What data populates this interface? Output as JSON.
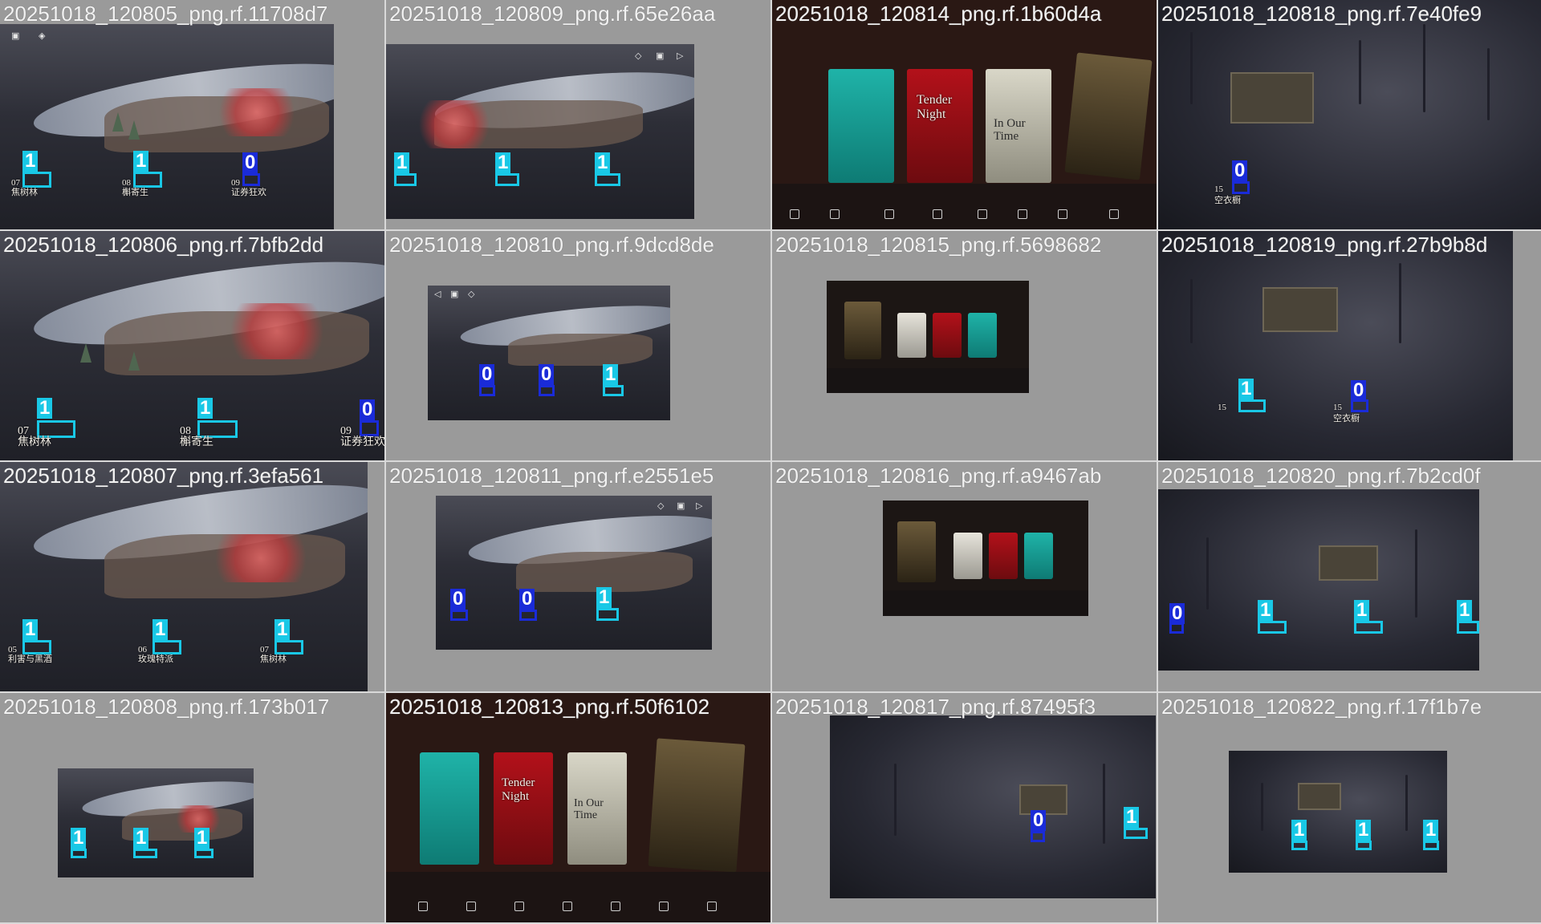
{
  "tiles": [
    {
      "title": "20251018_120805_png.rf.11708d7",
      "hud": [
        "▣",
        "◈"
      ],
      "labels": [
        {
          "cls": "1",
          "cap": "07",
          "name": "焦树林"
        },
        {
          "cls": "1",
          "cap": "08",
          "name": "槲寄生"
        },
        {
          "cls": "0",
          "cap": "09",
          "name": "证券狂欢"
        }
      ]
    },
    {
      "title": "20251018_120809_png.rf.65e26aa",
      "hud": [
        "◇",
        "▣",
        "▷"
      ],
      "labels": [
        {
          "cls": "1",
          "cap": "",
          "name": ""
        },
        {
          "cls": "1",
          "cap": "",
          "name": ""
        },
        {
          "cls": "1",
          "cap": "",
          "name": ""
        }
      ]
    },
    {
      "title": "20251018_120814_png.rf.1b60d4a",
      "cards": [
        "Tender Night",
        "In Our Time"
      ],
      "labels": []
    },
    {
      "title": "20251018_120818_png.rf.7e40fe9",
      "labels": [
        {
          "cls": "0",
          "cap": "15",
          "name": "空衣橱"
        }
      ]
    },
    {
      "title": "20251018_120806_png.rf.7bfb2dd",
      "labels": [
        {
          "cls": "1",
          "cap": "07",
          "name": "焦树林"
        },
        {
          "cls": "1",
          "cap": "08",
          "name": "槲寄生"
        },
        {
          "cls": "0",
          "cap": "09",
          "name": "证券狂欢"
        }
      ]
    },
    {
      "title": "20251018_120810_png.rf.9dcd8de",
      "hud": [
        "◁",
        "▣",
        "◇"
      ],
      "labels": [
        {
          "cls": "0",
          "cap": "",
          "name": ""
        },
        {
          "cls": "0",
          "cap": "",
          "name": ""
        },
        {
          "cls": "1",
          "cap": "",
          "name": ""
        }
      ]
    },
    {
      "title": "20251018_120815_png.rf.5698682",
      "labels": []
    },
    {
      "title": "20251018_120819_png.rf.27b9b8d",
      "labels": [
        {
          "cls": "1",
          "cap": "15",
          "name": ""
        },
        {
          "cls": "0",
          "cap": "15",
          "name": "空衣橱"
        }
      ]
    },
    {
      "title": "20251018_120807_png.rf.3efa561",
      "labels": [
        {
          "cls": "1",
          "cap": "05",
          "name": "利害与黑酒"
        },
        {
          "cls": "1",
          "cap": "06",
          "name": "玫瑰特派"
        },
        {
          "cls": "1",
          "cap": "07",
          "name": "焦树林"
        }
      ]
    },
    {
      "title": "20251018_120811_png.rf.e2551e5",
      "hud": [
        "◇",
        "▣",
        "▷"
      ],
      "labels": [
        {
          "cls": "0",
          "cap": "",
          "name": ""
        },
        {
          "cls": "0",
          "cap": "",
          "name": ""
        },
        {
          "cls": "1",
          "cap": "",
          "name": ""
        }
      ]
    },
    {
      "title": "20251018_120816_png.rf.a9467ab",
      "labels": []
    },
    {
      "title": "20251018_120820_png.rf.7b2cd0f",
      "labels": [
        {
          "cls": "0",
          "cap": "",
          "name": ""
        },
        {
          "cls": "1",
          "cap": "",
          "name": ""
        },
        {
          "cls": "1",
          "cap": "",
          "name": ""
        },
        {
          "cls": "1",
          "cap": "",
          "name": ""
        }
      ]
    },
    {
      "title": "20251018_120808_png.rf.173b017",
      "labels": [
        {
          "cls": "1"
        },
        {
          "cls": "1"
        },
        {
          "cls": "1"
        }
      ]
    },
    {
      "title": "20251018_120813_png.rf.50f6102",
      "cards": [
        "Tender Night",
        "In Our Time"
      ],
      "labels": []
    },
    {
      "title": "20251018_120817_png.rf.87495f3",
      "labels": [
        {
          "cls": "0",
          "cap": "",
          "name": ""
        },
        {
          "cls": "1",
          "cap": "",
          "name": ""
        }
      ]
    },
    {
      "title": "20251018_120822_png.rf.17f1b7e",
      "labels": [
        {
          "cls": "1"
        },
        {
          "cls": "1"
        },
        {
          "cls": "1"
        }
      ]
    }
  ]
}
